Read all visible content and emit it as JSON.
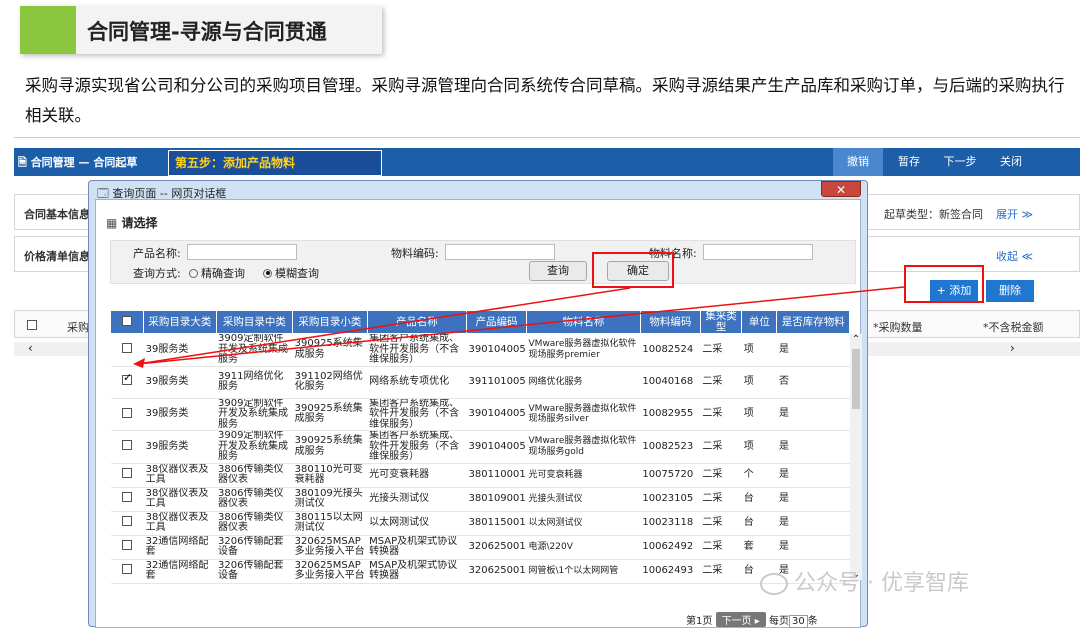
{
  "slide": {
    "title": "合同管理-寻源与合同贯通",
    "intro": "采购寻源实现省公司和分公司的采购项目管理。采购寻源管理向合同系统传合同草稿。采购寻源结果产生产品库和采购订单，与后端的采购执行相关联。",
    "watermark": "公众号 · 优享智库"
  },
  "app": {
    "breadcrumb": "合同管理 — 合同起草",
    "step_label": "第五步：添加产品物料",
    "toolbar": [
      "撤销",
      "暂存",
      "下一步",
      "关闭"
    ],
    "section_basic": "合同基本信息",
    "section_price": "价格清单信息",
    "draft_type_label": "起草类型：新签合同",
    "expand_label": "展开 ≫",
    "collapse_label": "收起 ≪",
    "add_label": "+ 添加",
    "delete_label": "删除",
    "col_purchase_type": "采购",
    "col_qty": "*采购数量",
    "col_price": "*不含税金额"
  },
  "dialog": {
    "caption": "查询页面 -- 网页对话框",
    "close": "✕",
    "heading": "请选择",
    "product_name_label": "产品名称:",
    "material_code_label": "物料编码:",
    "material_name_label": "物料名称:",
    "query_mode_label": "查询方式:",
    "exact": "精确查询",
    "fuzzy": "模糊查询",
    "query_btn": "查询",
    "confirm_btn": "确定",
    "columns": [
      "采购目录大类",
      "采购目录中类",
      "采购目录小类",
      "产品名称",
      "产品编码",
      "物料名称",
      "物料编码",
      "集采类型",
      "单位",
      "是否库存物料"
    ],
    "rows": [
      {
        "checked": false,
        "c1": "39服务类",
        "c2": "3909定制软件开发及系统集成服务",
        "c3": "390925系统集成服务",
        "c4": "集团客户系统集成、软件开发服务（不含维保服务）",
        "c5": "390104005",
        "c6": "VMware服务器虚拟化软件现场服务premier",
        "c7": "10082524",
        "c8": "二采",
        "c9": "项",
        "c10": "是"
      },
      {
        "checked": true,
        "c1": "39服务类",
        "c2": "3911网络优化服务",
        "c3": "391102网络优化服务",
        "c4": "网络系统专项优化",
        "c5": "391101005",
        "c6": "网络优化服务",
        "c7": "10040168",
        "c8": "二采",
        "c9": "项",
        "c10": "否"
      },
      {
        "checked": false,
        "c1": "39服务类",
        "c2": "3909定制软件开发及系统集成服务",
        "c3": "390925系统集成服务",
        "c4": "集团客户系统集成、软件开发服务（不含维保服务）",
        "c5": "390104005",
        "c6": "VMware服务器虚拟化软件现场服务silver",
        "c7": "10082955",
        "c8": "二采",
        "c9": "项",
        "c10": "是"
      },
      {
        "checked": false,
        "c1": "39服务类",
        "c2": "3909定制软件开发及系统集成服务",
        "c3": "390925系统集成服务",
        "c4": "集团客户系统集成、软件开发服务（不含维保服务）",
        "c5": "390104005",
        "c6": "VMware服务器虚拟化软件现场服务gold",
        "c7": "10082523",
        "c8": "二采",
        "c9": "项",
        "c10": "是"
      },
      {
        "checked": false,
        "c1": "38仪器仪表及工具",
        "c2": "3806传输类仪器仪表",
        "c3": "380110光可变衰耗器",
        "c4": "光可变衰耗器",
        "c5": "380110001",
        "c6": "光可变衰耗器",
        "c7": "10075720",
        "c8": "二采",
        "c9": "个",
        "c10": "是"
      },
      {
        "checked": false,
        "c1": "38仪器仪表及工具",
        "c2": "3806传输类仪器仪表",
        "c3": "380109光接头测试仪",
        "c4": "光接头测试仪",
        "c5": "380109001",
        "c6": "光接头测试仪",
        "c7": "10023105",
        "c8": "二采",
        "c9": "台",
        "c10": "是"
      },
      {
        "checked": false,
        "c1": "38仪器仪表及工具",
        "c2": "3806传输类仪器仪表",
        "c3": "380115以太网测试仪",
        "c4": "以太网测试仪",
        "c5": "380115001",
        "c6": "以太网测试仪",
        "c7": "10023118",
        "c8": "二采",
        "c9": "台",
        "c10": "是"
      },
      {
        "checked": false,
        "c1": "32通信网络配套",
        "c2": "3206传输配套设备",
        "c3": "320625MSAP多业务接入平台",
        "c4": "MSAP及机架式协议转换器",
        "c5": "320625001",
        "c6": "电源\\220V",
        "c7": "10062492",
        "c8": "二采",
        "c9": "套",
        "c10": "是"
      },
      {
        "checked": false,
        "c1": "32通信网络配套",
        "c2": "3206传输配套设备",
        "c3": "320625MSAP多业务接入平台",
        "c4": "MSAP及机架式协议转换器",
        "c5": "320625001",
        "c6": "网管板\\1个以太网网管",
        "c7": "10062493",
        "c8": "二采",
        "c9": "台",
        "c10": "是"
      }
    ],
    "page_label": "第1页",
    "next_page": "下一页 ▸",
    "per_page_prefix": "每页",
    "per_page": "30",
    "per_page_suffix": "条"
  },
  "colors": {
    "header_blue": "#1d5ea8",
    "grid_header": "#3d72bf",
    "highlight_red": "#e11",
    "accent_green": "#8cc63f"
  }
}
